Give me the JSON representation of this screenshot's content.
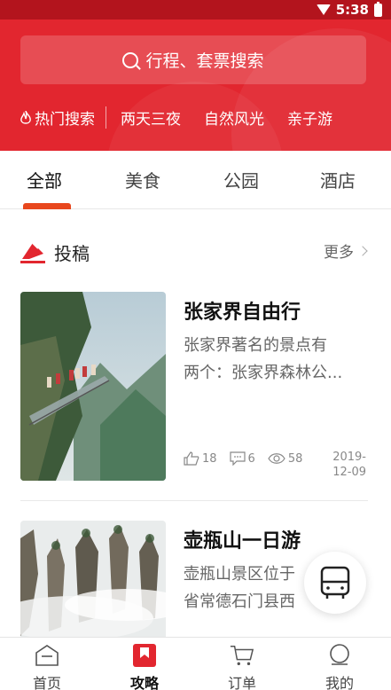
{
  "status_bar": {
    "time": "5:38"
  },
  "search": {
    "placeholder": "行程、套票搜索"
  },
  "hot": {
    "label": "热门搜索",
    "items": [
      "两天三夜",
      "自然风光",
      "亲子游"
    ]
  },
  "tabs": [
    {
      "label": "全部",
      "active": true
    },
    {
      "label": "美食",
      "active": false
    },
    {
      "label": "公园",
      "active": false
    },
    {
      "label": "酒店",
      "active": false
    }
  ],
  "section": {
    "title": "投稿",
    "more": "更多"
  },
  "articles": [
    {
      "title": "张家界自由行",
      "desc_line1": "张家界著名的景点有",
      "desc_line2": "两个：张家界森林公...",
      "likes": "18",
      "comments": "6",
      "views": "58",
      "date_line1": "2019-",
      "date_line2": "12-09"
    },
    {
      "title": "壶瓶山一日游",
      "desc_line1": "壶瓶山景区位于",
      "desc_line2": "省常德石门县西"
    }
  ],
  "bottom_nav": [
    {
      "label": "首页",
      "active": false
    },
    {
      "label": "攻略",
      "active": true
    },
    {
      "label": "订单",
      "active": false
    },
    {
      "label": "我的",
      "active": false
    }
  ],
  "colors": {
    "brand_red": "#e2262f",
    "accent_orange": "#e8471d"
  }
}
